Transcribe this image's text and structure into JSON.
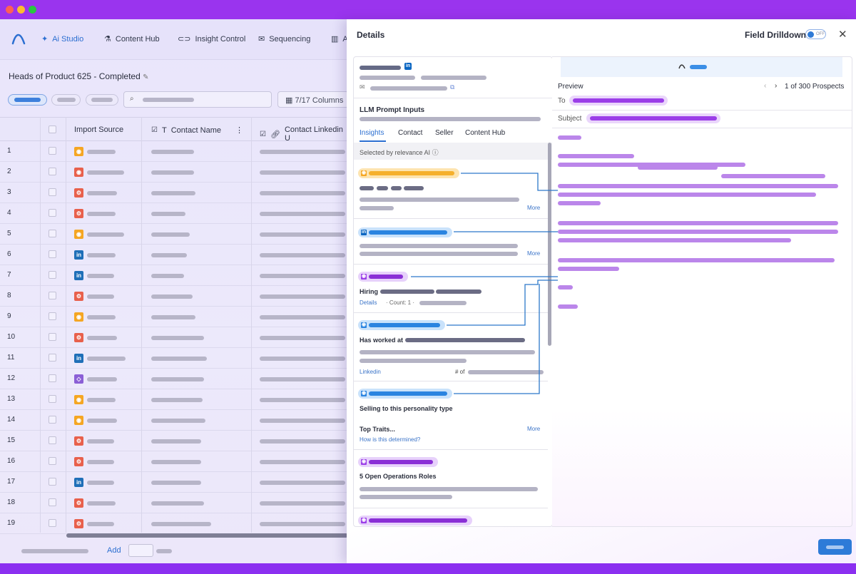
{
  "window": {
    "controls": [
      "close",
      "minimize",
      "zoom"
    ]
  },
  "nav": {
    "items": [
      {
        "label": "Ai Studio",
        "icon": "sparkle-icon",
        "active": true
      },
      {
        "label": "Content Hub",
        "icon": "content-hub-icon"
      },
      {
        "label": "Insight Control",
        "icon": "toggle-icon"
      },
      {
        "label": "Sequencing",
        "icon": "mail-icon"
      },
      {
        "label": "A",
        "icon": "analytics-icon"
      }
    ]
  },
  "page": {
    "title": "Heads of Product 625 - Completed",
    "columns_button": "7/17 Columns"
  },
  "table": {
    "headers": {
      "import_source": "Import Source",
      "contact_name": "Contact Name",
      "linkedin": "Contact Linkedin U"
    },
    "rows": [
      {
        "n": "1",
        "src": "rss"
      },
      {
        "n": "2",
        "src": "rss-red"
      },
      {
        "n": "3",
        "src": "hubspot"
      },
      {
        "n": "4",
        "src": "hubspot"
      },
      {
        "n": "5",
        "src": "rss"
      },
      {
        "n": "6",
        "src": "linkedin"
      },
      {
        "n": "7",
        "src": "linkedin"
      },
      {
        "n": "8",
        "src": "hubspot"
      },
      {
        "n": "9",
        "src": "rss"
      },
      {
        "n": "10",
        "src": "hubspot"
      },
      {
        "n": "11",
        "src": "linkedin"
      },
      {
        "n": "12",
        "src": "purple"
      },
      {
        "n": "13",
        "src": "rss"
      },
      {
        "n": "14",
        "src": "rss"
      },
      {
        "n": "15",
        "src": "hubspot"
      },
      {
        "n": "16",
        "src": "hubspot"
      },
      {
        "n": "17",
        "src": "linkedin"
      },
      {
        "n": "18",
        "src": "hubspot"
      },
      {
        "n": "19",
        "src": "hubspot"
      }
    ]
  },
  "footer": {
    "add_label": "Add"
  },
  "details": {
    "title": "Details",
    "field_drilldown_label": "Field Drilldown:",
    "toggle_state": "OFF",
    "llm_section": "LLM Prompt Inputs",
    "tabs": [
      "Insights",
      "Contact",
      "Seller",
      "Content Hub"
    ],
    "relevance_label": "Selected by relevance AI",
    "cards": {
      "more": "More",
      "hiring": "Hiring",
      "details_link": "Details",
      "count": "· Count: 1 ·",
      "has_worked_at": "Has worked at",
      "linkedin_link": "Linkedin",
      "num_of": "# of",
      "selling_title": "Selling to this personality type",
      "top_traits": "Top Traits...",
      "how_determined": "How is this determined?",
      "ops_roles": "5 Open Operations Roles"
    },
    "preview": {
      "label": "Preview",
      "to_label": "To",
      "subject_label": "Subject",
      "pagination": "1 of 300 Prospects"
    }
  },
  "colors": {
    "accent": "#2c6fd1",
    "brand_purple": "#8b2ff0",
    "highlight_purple": "#9b3ee8",
    "highlight_orange": "#f5b02c",
    "linkedin_blue": "#0a66c2"
  }
}
